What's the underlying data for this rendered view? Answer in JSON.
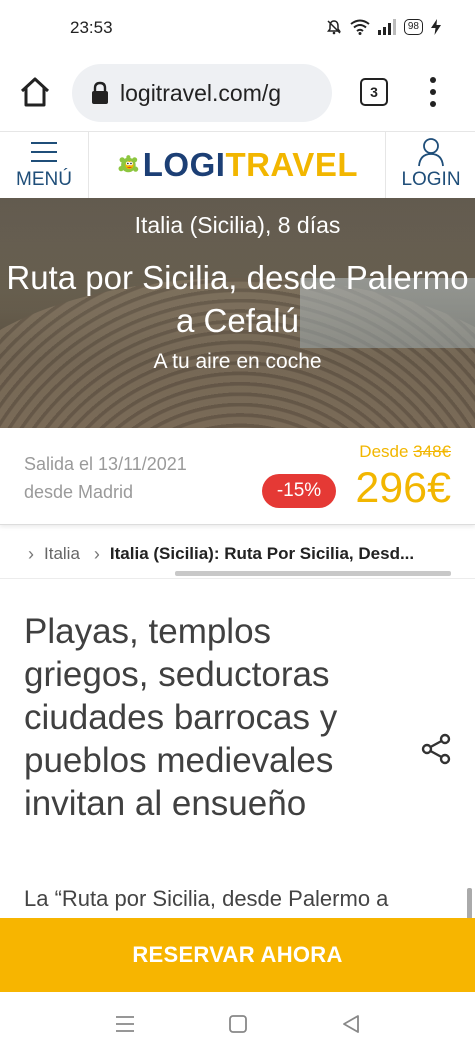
{
  "status_bar": {
    "time": "23:53",
    "battery": "98"
  },
  "browser": {
    "url": "logitravel.com/g",
    "tab_count": "3"
  },
  "site_header": {
    "menu_label": "MENÚ",
    "logo_part1": "LOGI",
    "logo_part2": "TRAVEL",
    "login_label": "LOGIN"
  },
  "hero": {
    "subtitle": "Italia (Sicilia), 8 días",
    "title": "Ruta por Sicilia, desde Palermo a Cefalú",
    "tagline": "A tu aire en coche"
  },
  "pricing": {
    "departure_date": "Salida el 13/11/2021",
    "departure_from": "desde Madrid",
    "desde_label": "Desde",
    "old_price": "348€",
    "discount": "-15%",
    "price": "296€"
  },
  "breadcrumb": {
    "items": [
      "Italia",
      "Italia (Sicilia): Ruta Por Sicilia, Desd..."
    ]
  },
  "content": {
    "heading": "Playas, templos griegos, seductoras ciudades barrocas y pueblos medievales invitan al ensueño",
    "intro": "La “Ruta por Sicilia, desde Palermo a"
  },
  "cta": {
    "reserve_label": "RESERVAR AHORA"
  },
  "colors": {
    "brand_blue": "#1c3f75",
    "brand_yellow": "#f2b600",
    "cta_yellow": "#f7b500",
    "discount_red": "#e53935"
  }
}
